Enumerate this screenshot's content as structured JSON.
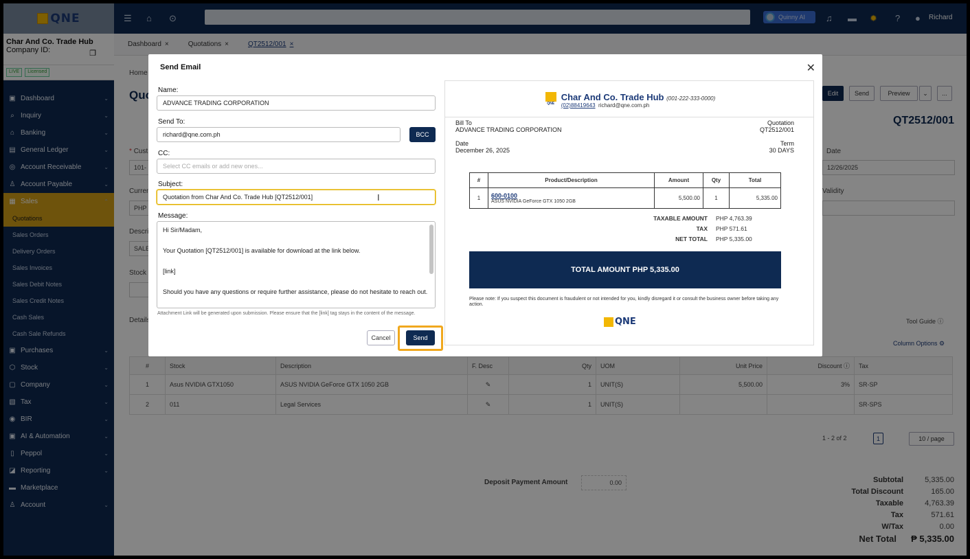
{
  "sidebar": {
    "logo": "QNE",
    "company_name": "Char And Co. Trade Hub",
    "company_id_label": "Company ID:",
    "badges": [
      "LIVE",
      "Licensed"
    ],
    "items": [
      {
        "label": "Dashboard",
        "icon": "dashboard-icon"
      },
      {
        "label": "Inquiry",
        "icon": "inquiry-icon"
      },
      {
        "label": "Banking",
        "icon": "bank-icon"
      },
      {
        "label": "General Ledger",
        "icon": "ledger-icon"
      },
      {
        "label": "Account Receivable",
        "icon": "receivable-icon"
      },
      {
        "label": "Account Payable",
        "icon": "payable-icon"
      },
      {
        "label": "Sales",
        "icon": "sales-icon"
      },
      {
        "label": "Purchases",
        "icon": "purchases-icon"
      },
      {
        "label": "Stock",
        "icon": "stock-icon"
      },
      {
        "label": "Company",
        "icon": "company-icon"
      },
      {
        "label": "Tax",
        "icon": "tax-icon"
      },
      {
        "label": "BIR",
        "icon": "bir-icon"
      },
      {
        "label": "AI & Automation",
        "icon": "ai-icon"
      },
      {
        "label": "Peppol",
        "icon": "peppol-icon"
      },
      {
        "label": "Reporting",
        "icon": "reporting-icon"
      },
      {
        "label": "Marketplace",
        "icon": "marketplace-icon"
      },
      {
        "label": "Account",
        "icon": "account-icon"
      }
    ],
    "sales_sub": [
      "Quotations",
      "Sales Orders",
      "Delivery Orders",
      "Sales Invoices",
      "Sales Debit Notes",
      "Sales Credit Notes",
      "Cash Sales",
      "Cash Sale Refunds"
    ]
  },
  "topbar": {
    "ai_label": "Quinny AI",
    "user": "Richard"
  },
  "tabs": [
    "Dashboard",
    "Quotations",
    "QT2512/001"
  ],
  "page": {
    "breadcrumb": "Home",
    "title": "Quo",
    "doc_no": "QT2512/001",
    "buttons": {
      "edit": "Edit",
      "send": "Send",
      "preview": "Preview",
      "more": "..."
    },
    "customer_label": "Cust",
    "customer_val": "101-",
    "currency_label": "Curren",
    "currency_val": "PHP",
    "desc_label": "Descri",
    "desc_val": "SALE",
    "stock_label": "Stock L",
    "details_tab": "Details",
    "date_label": "Date",
    "date_val": "12/26/2025",
    "validity_label": "Validity",
    "tool_guide": "Tool Guide",
    "column_options": "Column Options",
    "table": {
      "headers": [
        "#",
        "Stock",
        "Description",
        "F. Desc",
        "Qty",
        "UOM",
        "Unit Price",
        "Discount",
        "Tax"
      ],
      "rows": [
        [
          "1",
          "Asus NVIDIA GTX1050",
          "ASUS NVIDIA GeForce GTX 1050 2GB",
          "",
          "1",
          "UNIT(S)",
          "5,500.00",
          "3%",
          "SR-SP"
        ],
        [
          "2",
          "011",
          "Legal Services",
          "",
          "1",
          "UNIT(S)",
          "",
          "",
          "SR-SPS"
        ]
      ]
    },
    "pagination": {
      "range": "1 - 2 of 2",
      "page": "1",
      "per_page": "10 / page"
    },
    "deposit_label": "Deposit Payment Amount",
    "deposit_val": "0.00",
    "totals": [
      {
        "label": "Subtotal",
        "value": "5,335.00"
      },
      {
        "label": "Total Discount",
        "value": "165.00"
      },
      {
        "label": "Taxable",
        "value": "4,763.39"
      },
      {
        "label": "Tax",
        "value": "571.61"
      },
      {
        "label": "W/Tax",
        "value": "0.00"
      },
      {
        "label": "Net Total",
        "value": "₱ 5,335.00"
      }
    ]
  },
  "modal": {
    "title": "Send Email",
    "name_label": "Name:",
    "name_val": "ADVANCE TRADING CORPORATION",
    "sendto_label": "Send To:",
    "sendto_val": "richard@qne.com.ph",
    "bcc_label": "BCC",
    "cc_label": "CC:",
    "cc_placeholder": "Select CC emails or add new ones...",
    "subject_label": "Subject:",
    "subject_val": "Quotation from Char And Co. Trade Hub [QT2512/001]",
    "message_label": "Message:",
    "message_lines": [
      "Hi Sir/Madam,",
      "Your Quotation [QT2512/001] is available for download at the link below.",
      "[link]",
      "Should you have any questions or require further assistance, please do not hesitate to reach out."
    ],
    "note": "Attachment Link will be generated upon submission. Please ensure that the [link] tag stays in the content of the message.",
    "cancel_label": "Cancel",
    "send_label": "Send"
  },
  "preview": {
    "company": "Char And Co. Trade Hub",
    "company_tin": "(001-222-333-0000)",
    "phone": "(02)88419643",
    "email": "richard@qne.com.ph",
    "bill_to_label": "Bill To",
    "bill_to_val": "ADVANCE TRADING CORPORATION",
    "doc_type": "Quotation",
    "doc_no": "QT2512/001",
    "date_label": "Date",
    "date_val": "December 26, 2025",
    "term_label": "Term",
    "term_val": "30 DAYS",
    "table_headers": [
      "#",
      "Product/Description",
      "Amount",
      "Qty",
      "Total"
    ],
    "row": {
      "no": "1",
      "code": "600-0100",
      "desc": "ASUS NVIDIA GeForce GTX 1050 2GB",
      "amount": "5,500.00",
      "qty": "1",
      "total": "5,335.00"
    },
    "taxable_label": "TAXABLE AMOUNT",
    "taxable_val": "PHP 4,763.39",
    "tax_label": "TAX",
    "tax_val": "PHP 571.61",
    "net_label": "NET TOTAL",
    "net_val": "PHP 5,335.00",
    "total_amount": "TOTAL AMOUNT   PHP 5,335.00",
    "note": "Please note: If you suspect this document is fraudulent or not intended for you, kindly disregard it or consult the business owner before taking any action.",
    "footer_logo": "QNE"
  }
}
